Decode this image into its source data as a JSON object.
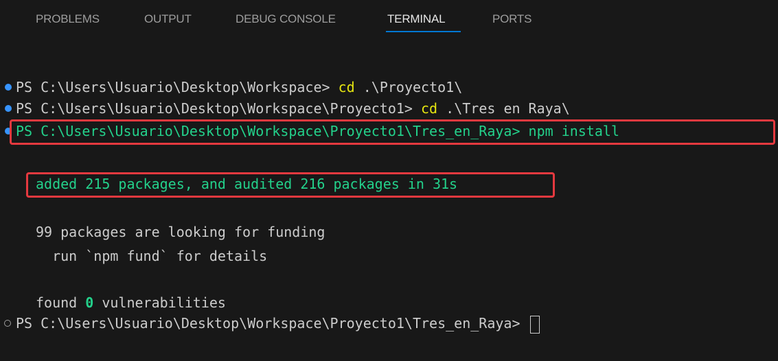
{
  "panel": {
    "tabs": [
      {
        "label": "PROBLEMS"
      },
      {
        "label": "OUTPUT"
      },
      {
        "label": "DEBUG CONSOLE"
      },
      {
        "label": "TERMINAL"
      },
      {
        "label": "PORTS"
      }
    ],
    "active_tab": "TERMINAL"
  },
  "terminal": {
    "line1": {
      "prompt": "PS C:\\Users\\Usuario\\Desktop\\Workspace> ",
      "cmd": "cd",
      "args": " .\\Proyecto1\\"
    },
    "line2": {
      "prompt": "PS C:\\Users\\Usuario\\Desktop\\Workspace\\Proyecto1> ",
      "cmd": "cd",
      "args": " .\\Tres en Raya\\"
    },
    "line3": {
      "prompt": "PS C:\\Users\\Usuario\\Desktop\\Workspace\\Proyecto1\\Tres_en_Raya> ",
      "cmd": "npm install"
    },
    "added": "added 215 packages, and audited 216 packages in 31s",
    "funding": "99 packages are looking for funding",
    "fund_hint": "  run `npm fund` for details",
    "found_prefix": "found ",
    "found_count": "0",
    "found_suffix": " vulnerabilities",
    "last_prompt": "PS C:\\Users\\Usuario\\Desktop\\Workspace\\Proyecto1\\Tres_en_Raya> "
  },
  "colors": {
    "background": "#181818",
    "active_tab_underline": "#0078d4",
    "highlight_box": "#e5393f",
    "command_yellow": "#e5e510",
    "success_green": "#23d18b",
    "decoration_blue": "#3794ff"
  }
}
